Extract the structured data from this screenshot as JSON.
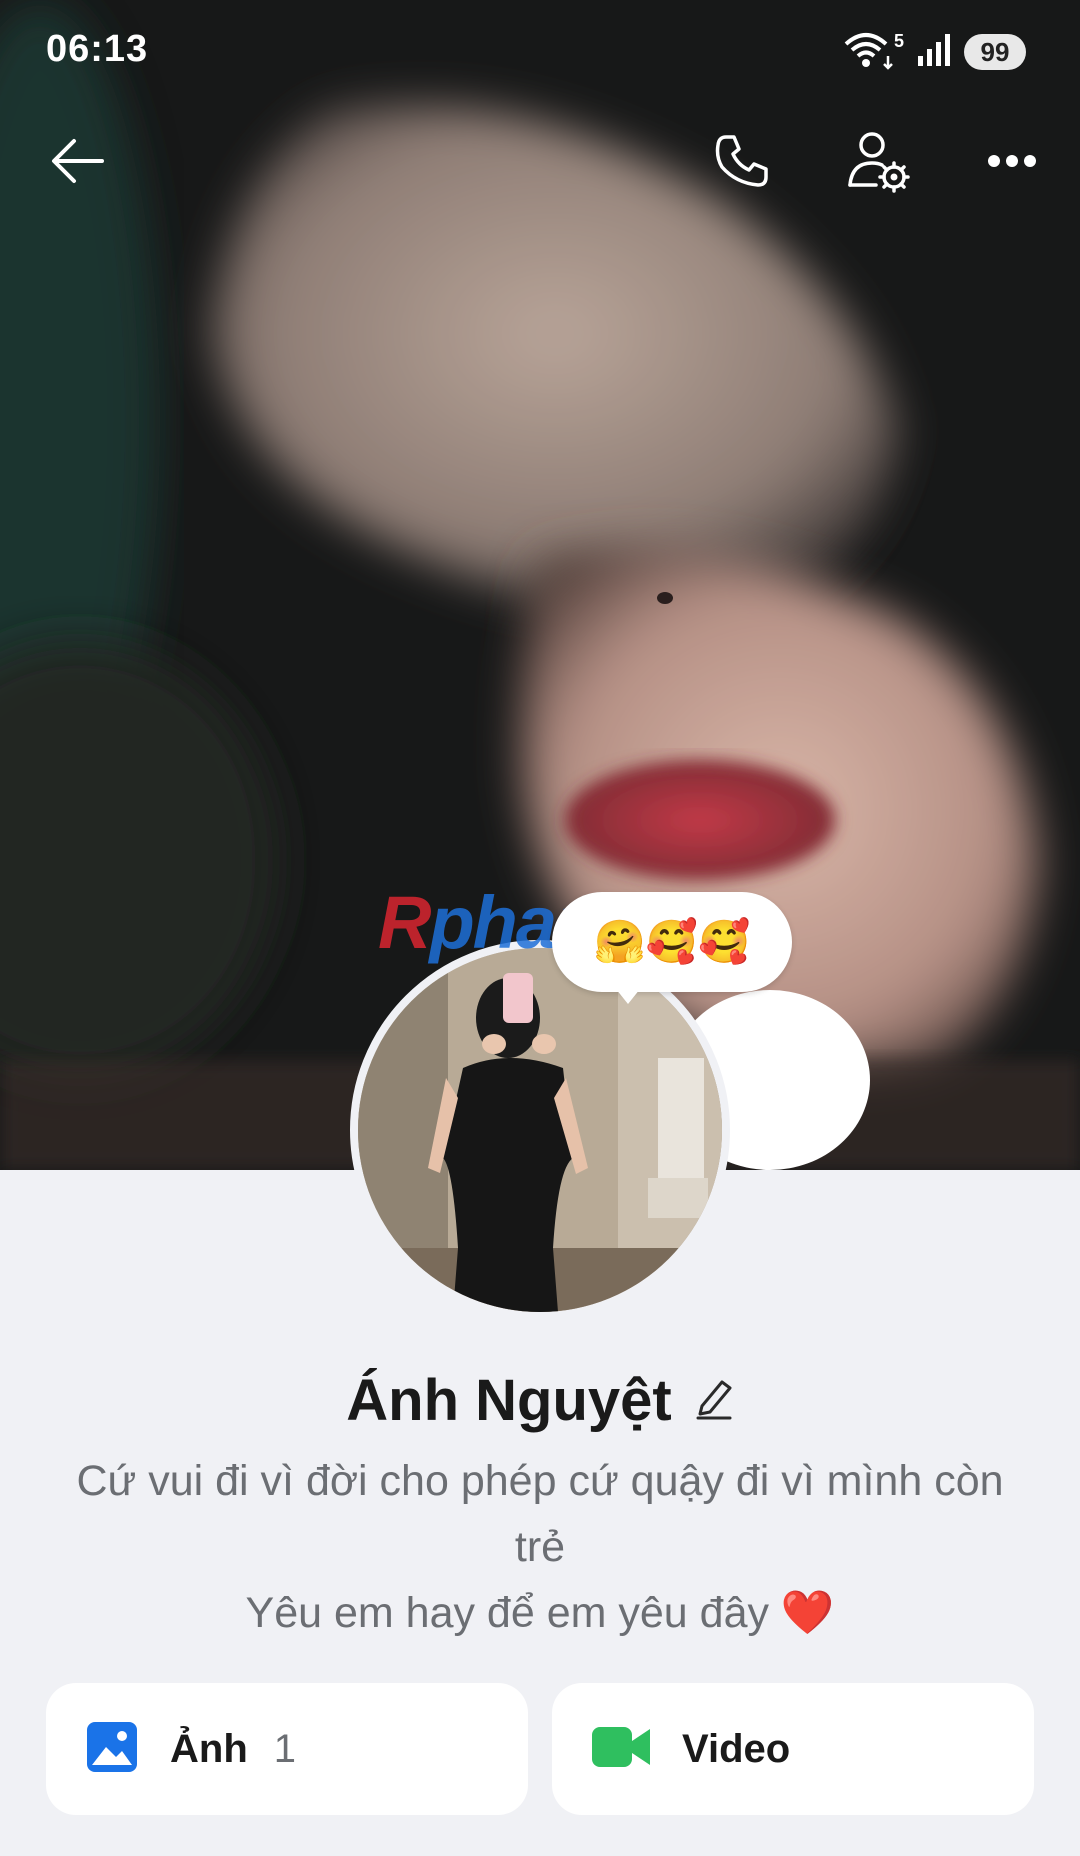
{
  "status_bar": {
    "time": "06:13",
    "wifi_label": "5",
    "battery": "99"
  },
  "top_nav": {
    "back_icon": "back-arrow-icon",
    "call_icon": "phone-icon",
    "settings_icon": "user-settings-icon",
    "more_icon": "more-dots-icon"
  },
  "watermark": {
    "first": "R",
    "rest": "phang"
  },
  "status_bubble": {
    "emojis": "🤗🥰🥰"
  },
  "profile": {
    "name": "Ánh Nguyệt",
    "edit_icon": "pencil-icon",
    "bio_line1": "Cứ vui đi vì đời cho phép cứ quậy đi vì mình còn trẻ",
    "bio_line2": "Yêu em hay để em yêu đây ❤️"
  },
  "media": {
    "photos_label": "Ảnh",
    "photos_count": "1",
    "video_label": "Video"
  },
  "colors": {
    "background": "#f0f1f5",
    "photo_icon": "#1a73e8",
    "video_icon": "#2fbf5f"
  }
}
